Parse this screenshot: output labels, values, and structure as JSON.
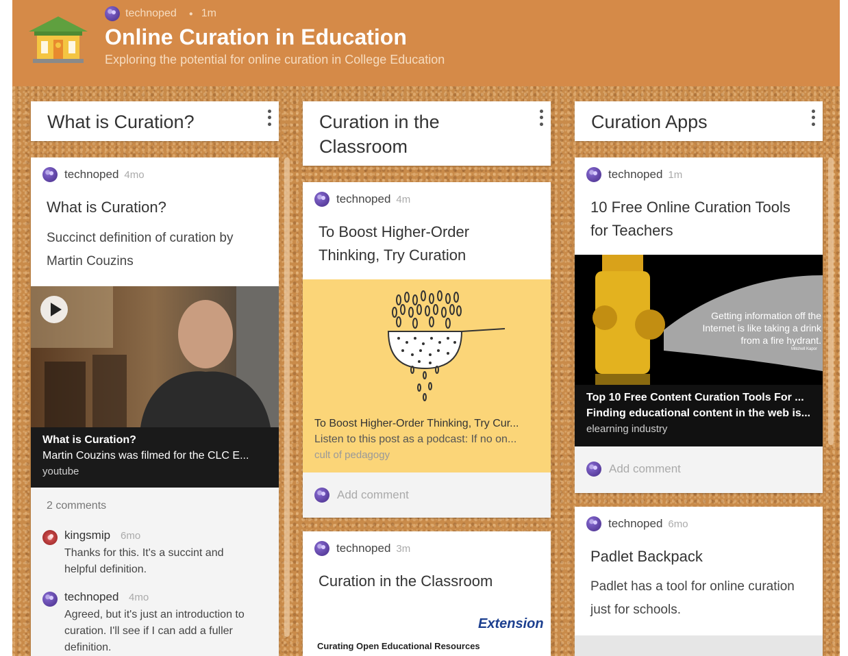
{
  "header": {
    "author": "technoped",
    "time": "1m",
    "title": "Online Curation in Education",
    "subtitle": "Exploring the potential for online curation in College Education"
  },
  "columns": [
    {
      "title": "What is Curation?",
      "card1": {
        "author": "technoped",
        "time": "4mo",
        "title": "What is Curation?",
        "body": "Succinct definition of curation by Martin Couzins",
        "media": {
          "title": "What is Curation?",
          "desc": "Martin Couzins was filmed for the CLC E...",
          "source": "youtube"
        },
        "comments_count": "2 comments",
        "comments": [
          {
            "author": "kingsmip",
            "time": "6mo",
            "text": "Thanks for this. It's a succint and helpful definition."
          },
          {
            "author": "technoped",
            "time": "4mo",
            "text": "Agreed, but it's just an introduction to curation. I'll see if I can add a fuller definition."
          }
        ]
      }
    },
    {
      "title": "Curation in the Classroom",
      "card1": {
        "author": "technoped",
        "time": "4m",
        "title": "To Boost Higher-Order Thinking, Try Curation",
        "media": {
          "title": "To Boost Higher-Order Thinking, Try Cur...",
          "desc": "Listen to this post as a podcast: If no on...",
          "source": "cult of pedagogy",
          "bg": "#fbd578"
        },
        "add_comment": "Add comment"
      },
      "card2": {
        "author": "technoped",
        "time": "3m",
        "title": "Curation in the Classroom",
        "logo_text": "Extension",
        "image_caption": "Curating Open Educational Resources"
      }
    },
    {
      "title": "Curation Apps",
      "card1": {
        "author": "technoped",
        "time": "1m",
        "title": "10 Free Online Curation Tools for Teachers",
        "image_quote": "Getting information off the Internet is like taking a drink from a fire hydrant.",
        "image_quote_author": "Mitchell Kapor",
        "media": {
          "title": "Top 10 Free Content Curation Tools For ...",
          "desc": "Finding educational content in the web is...",
          "source": "elearning industry"
        },
        "add_comment": "Add comment"
      },
      "card2": {
        "author": "technoped",
        "time": "6mo",
        "title": "Padlet Backpack",
        "body": "Padlet has a tool for online curation just for schools."
      }
    }
  ],
  "colors": {
    "header_bg": "#d58a48",
    "board_bg": "#c98b4a",
    "card_bg": "#ffffff",
    "link_media_bg": "#fbd578",
    "avatar": "#7b5fc4"
  }
}
